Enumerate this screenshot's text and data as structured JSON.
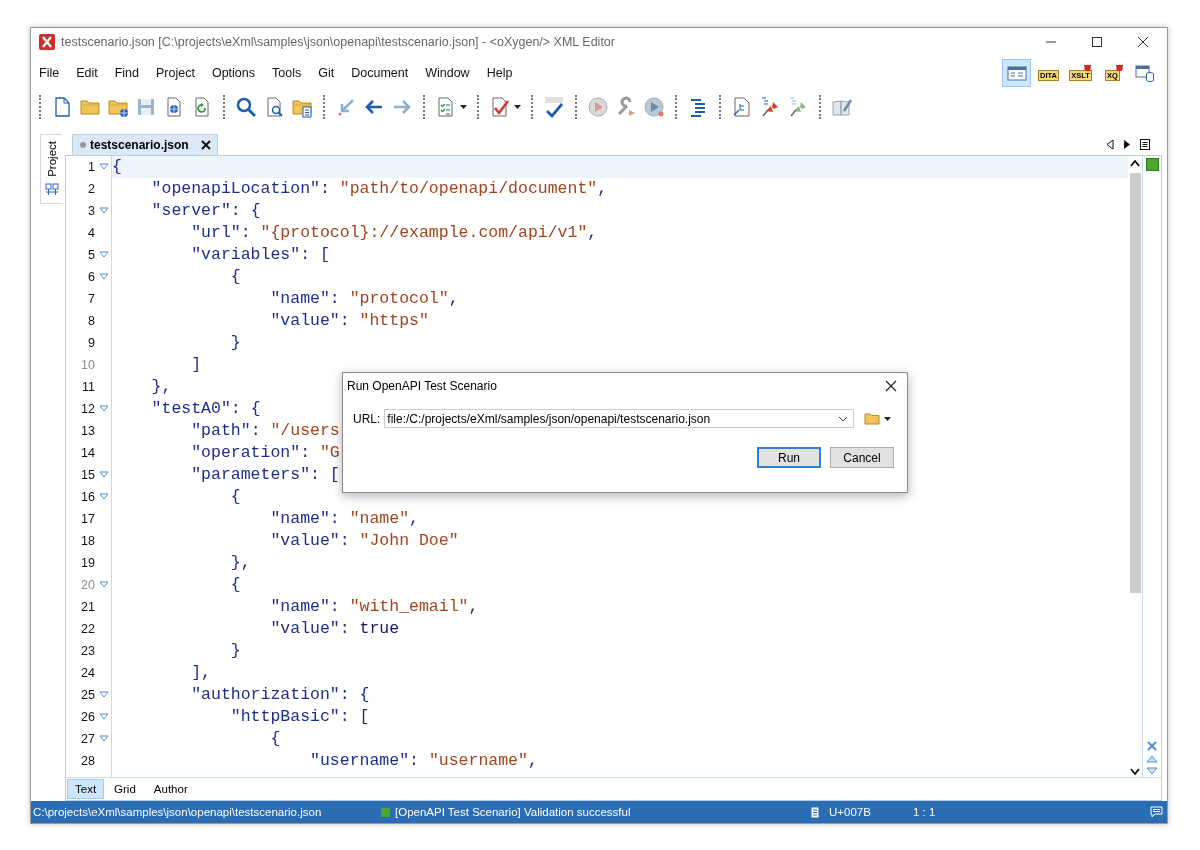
{
  "window": {
    "title": "testscenario.json [C:\\projects\\eXml\\samples\\json\\openapi\\testscenario.json] - <oXygen/> XML Editor"
  },
  "menu": [
    "File",
    "Edit",
    "Find",
    "Project",
    "Options",
    "Tools",
    "Git",
    "Document",
    "Window",
    "Help"
  ],
  "perspectives": [
    {
      "kind": "editor",
      "selected": true
    },
    {
      "kind": "badge",
      "label": "DITA",
      "debug": false,
      "selected": false
    },
    {
      "kind": "badge",
      "label": "XSLT",
      "debug": true,
      "selected": false
    },
    {
      "kind": "badge",
      "label": "XQ",
      "debug": true,
      "selected": false
    },
    {
      "kind": "database",
      "selected": false
    }
  ],
  "side_panel": {
    "label": "Project"
  },
  "editor_tab": {
    "label": "testscenario.json",
    "modified": false
  },
  "lines": [
    {
      "n": "1",
      "fold": true,
      "dim": false,
      "current": true,
      "tokens": [
        {
          "kind": "pun",
          "t": "{"
        }
      ]
    },
    {
      "n": "2",
      "fold": false,
      "dim": false,
      "current": false,
      "tokens": [
        {
          "kind": "key",
          "t": "    \"openapiLocation\""
        },
        {
          "kind": "pun",
          "t": ": "
        },
        {
          "kind": "str",
          "t": "\"path/to/openapi/document\""
        },
        {
          "kind": "pun",
          "t": ","
        }
      ]
    },
    {
      "n": "3",
      "fold": true,
      "dim": false,
      "current": false,
      "tokens": [
        {
          "kind": "key",
          "t": "    \"server\""
        },
        {
          "kind": "pun",
          "t": ": {"
        }
      ]
    },
    {
      "n": "4",
      "fold": false,
      "dim": false,
      "current": false,
      "tokens": [
        {
          "kind": "key",
          "t": "        \"url\""
        },
        {
          "kind": "pun",
          "t": ": "
        },
        {
          "kind": "str",
          "t": "\"{protocol}://example.com/api/v1\""
        },
        {
          "kind": "pun",
          "t": ","
        }
      ]
    },
    {
      "n": "5",
      "fold": true,
      "dim": false,
      "current": false,
      "tokens": [
        {
          "kind": "key",
          "t": "        \"variables\""
        },
        {
          "kind": "pun",
          "t": ": ["
        }
      ]
    },
    {
      "n": "6",
      "fold": true,
      "dim": false,
      "current": false,
      "tokens": [
        {
          "kind": "pun",
          "t": "            {"
        }
      ]
    },
    {
      "n": "7",
      "fold": false,
      "dim": false,
      "current": false,
      "tokens": [
        {
          "kind": "key",
          "t": "                \"name\""
        },
        {
          "kind": "pun",
          "t": ": "
        },
        {
          "kind": "str",
          "t": "\"protocol\""
        },
        {
          "kind": "pun",
          "t": ","
        }
      ]
    },
    {
      "n": "8",
      "fold": false,
      "dim": false,
      "current": false,
      "tokens": [
        {
          "kind": "key",
          "t": "                \"value\""
        },
        {
          "kind": "pun",
          "t": ": "
        },
        {
          "kind": "str",
          "t": "\"https\""
        }
      ]
    },
    {
      "n": "9",
      "fold": false,
      "dim": false,
      "current": false,
      "tokens": [
        {
          "kind": "pun",
          "t": "            }"
        }
      ]
    },
    {
      "n": "10",
      "fold": false,
      "dim": true,
      "current": false,
      "tokens": [
        {
          "kind": "pun",
          "t": "        ]"
        }
      ]
    },
    {
      "n": "11",
      "fold": false,
      "dim": false,
      "current": false,
      "tokens": [
        {
          "kind": "pun",
          "t": "    },"
        }
      ]
    },
    {
      "n": "12",
      "fold": true,
      "dim": false,
      "current": false,
      "tokens": [
        {
          "kind": "key",
          "t": "    \"testA0\""
        },
        {
          "kind": "pun",
          "t": ": {"
        }
      ]
    },
    {
      "n": "13",
      "fold": false,
      "dim": false,
      "current": false,
      "tokens": [
        {
          "kind": "key",
          "t": "        \"path\""
        },
        {
          "kind": "pun",
          "t": ": "
        },
        {
          "kind": "str",
          "t": "\"/users"
        }
      ]
    },
    {
      "n": "14",
      "fold": false,
      "dim": false,
      "current": false,
      "tokens": [
        {
          "kind": "key",
          "t": "        \"operation\""
        },
        {
          "kind": "pun",
          "t": ": "
        },
        {
          "kind": "str",
          "t": "\"G"
        }
      ]
    },
    {
      "n": "15",
      "fold": true,
      "dim": false,
      "current": false,
      "tokens": [
        {
          "kind": "key",
          "t": "        \"parameters\""
        },
        {
          "kind": "pun",
          "t": ": ["
        }
      ]
    },
    {
      "n": "16",
      "fold": true,
      "dim": false,
      "current": false,
      "tokens": [
        {
          "kind": "pun",
          "t": "            {"
        }
      ]
    },
    {
      "n": "17",
      "fold": false,
      "dim": false,
      "current": false,
      "tokens": [
        {
          "kind": "key",
          "t": "                \"name\""
        },
        {
          "kind": "pun",
          "t": ": "
        },
        {
          "kind": "str",
          "t": "\"name\""
        },
        {
          "kind": "pun",
          "t": ","
        }
      ]
    },
    {
      "n": "18",
      "fold": false,
      "dim": false,
      "current": false,
      "tokens": [
        {
          "kind": "key",
          "t": "                \"value\""
        },
        {
          "kind": "pun",
          "t": ": "
        },
        {
          "kind": "str",
          "t": "\"John Doe\""
        }
      ]
    },
    {
      "n": "19",
      "fold": false,
      "dim": false,
      "current": false,
      "tokens": [
        {
          "kind": "pun",
          "t": "            },"
        }
      ]
    },
    {
      "n": "20",
      "fold": true,
      "dim": true,
      "current": false,
      "tokens": [
        {
          "kind": "pun",
          "t": "            {"
        }
      ]
    },
    {
      "n": "21",
      "fold": false,
      "dim": false,
      "current": false,
      "tokens": [
        {
          "kind": "key",
          "t": "                \"name\""
        },
        {
          "kind": "pun",
          "t": ": "
        },
        {
          "kind": "str",
          "t": "\"with_email\""
        },
        {
          "kind": "pun",
          "t": ","
        }
      ]
    },
    {
      "n": "22",
      "fold": false,
      "dim": false,
      "current": false,
      "tokens": [
        {
          "kind": "key",
          "t": "                \"value\""
        },
        {
          "kind": "pun",
          "t": ": "
        },
        {
          "kind": "lit",
          "t": "true"
        }
      ]
    },
    {
      "n": "23",
      "fold": false,
      "dim": false,
      "current": false,
      "tokens": [
        {
          "kind": "pun",
          "t": "            }"
        }
      ]
    },
    {
      "n": "24",
      "fold": false,
      "dim": false,
      "current": false,
      "tokens": [
        {
          "kind": "pun",
          "t": "        ],"
        }
      ]
    },
    {
      "n": "25",
      "fold": true,
      "dim": false,
      "current": false,
      "tokens": [
        {
          "kind": "key",
          "t": "        \"authorization\""
        },
        {
          "kind": "pun",
          "t": ": {"
        }
      ]
    },
    {
      "n": "26",
      "fold": true,
      "dim": false,
      "current": false,
      "tokens": [
        {
          "kind": "key",
          "t": "            \"httpBasic\""
        },
        {
          "kind": "pun",
          "t": ": ["
        }
      ]
    },
    {
      "n": "27",
      "fold": true,
      "dim": false,
      "current": false,
      "tokens": [
        {
          "kind": "pun",
          "t": "                {"
        }
      ]
    },
    {
      "n": "28",
      "fold": false,
      "dim": false,
      "current": false,
      "tokens": [
        {
          "kind": "key",
          "t": "                    \"username\""
        },
        {
          "kind": "pun",
          "t": ": "
        },
        {
          "kind": "str",
          "t": "\"username\""
        },
        {
          "kind": "pun",
          "t": ","
        }
      ]
    }
  ],
  "mode_tabs": [
    {
      "label": "Text",
      "selected": true
    },
    {
      "label": "Grid",
      "selected": false
    },
    {
      "label": "Author",
      "selected": false
    }
  ],
  "dialog": {
    "title": "Run OpenAPI Test Scenario",
    "url_label": "URL:",
    "url_value": "file:/C:/projects/eXml/samples/json/openapi/testscenario.json",
    "buttons": [
      {
        "label": "Run",
        "default": true
      },
      {
        "label": "Cancel",
        "default": false
      }
    ]
  },
  "status_bar": {
    "path": "C:\\projects\\eXml\\samples\\json\\openapi\\testscenario.json",
    "message": "[OpenAPI Test Scenario] Validation successful",
    "valid": true,
    "char_code": "U+007B",
    "position": "1 : 1"
  }
}
